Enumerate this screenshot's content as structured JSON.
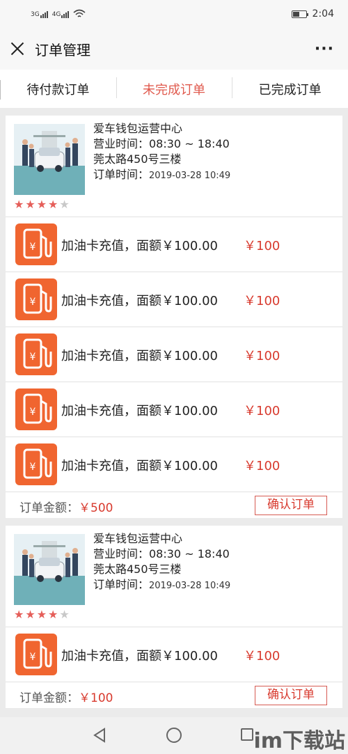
{
  "status_bar": {
    "time": "2:04",
    "sig1": "3G",
    "sig2": "4G"
  },
  "nav": {
    "title": "订单管理",
    "more": "···"
  },
  "tabs": [
    {
      "label": "待付款订单",
      "active": false
    },
    {
      "label": "未完成订单",
      "active": true
    },
    {
      "label": "已完成订单",
      "active": false
    }
  ],
  "orders": [
    {
      "shop_name": "爱车钱包运营中心",
      "hours": "营业时间：08:30 ~ 18:40",
      "address": "莞太路450号三楼",
      "order_time_label": "订单时间：",
      "order_time": "2019-03-28 10:49",
      "rating": 4,
      "items": [
        {
          "name": "加油卡充值，面额￥100.00",
          "price": "￥100"
        },
        {
          "name": "加油卡充值，面额￥100.00",
          "price": "￥100"
        },
        {
          "name": "加油卡充值，面额￥100.00",
          "price": "￥100"
        },
        {
          "name": "加油卡充值，面额￥100.00",
          "price": "￥100"
        },
        {
          "name": "加油卡充值，面额￥100.00",
          "price": "￥100"
        }
      ],
      "total_label": "订单金额：",
      "total": "￥500",
      "confirm_label": "确认订单"
    },
    {
      "shop_name": "爱车钱包运营中心",
      "hours": "营业时间：08:30 ~ 18:40",
      "address": "莞太路450号三楼",
      "order_time_label": "订单时间：",
      "order_time": "2019-03-28 10:49",
      "rating": 4,
      "items": [
        {
          "name": "加油卡充值，面额￥100.00",
          "price": "￥100"
        }
      ],
      "total_label": "订单金额：",
      "total": "￥100",
      "confirm_label": "确认订单"
    }
  ],
  "watermark": "im下载站",
  "colors": {
    "accent": "#e05a4e",
    "price": "#d83a2e",
    "icon_bg": "#f06530"
  }
}
